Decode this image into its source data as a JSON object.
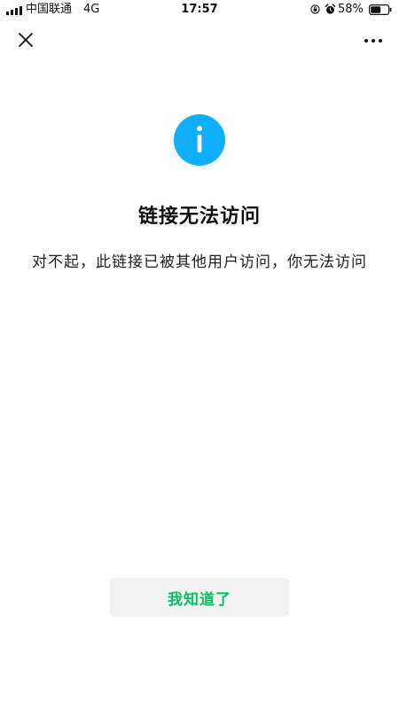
{
  "status_bar": {
    "carrier": "中国联通",
    "network": "4G",
    "time": "17:57",
    "battery_percent": "58%",
    "battery_level": 0.58,
    "signal_bars": 4
  },
  "header": {
    "close_icon": "close-icon",
    "more_icon": "more-icon"
  },
  "main": {
    "icon": "info-icon",
    "title": "链接无法访问",
    "message": "对不起，此链接已被其他用户访问，你无法访问"
  },
  "actions": {
    "ok_label": "我知道了"
  },
  "colors": {
    "accent": "#07c160",
    "info_icon": "#10aeff",
    "button_bg": "#f2f2f2",
    "text": "#111111"
  }
}
